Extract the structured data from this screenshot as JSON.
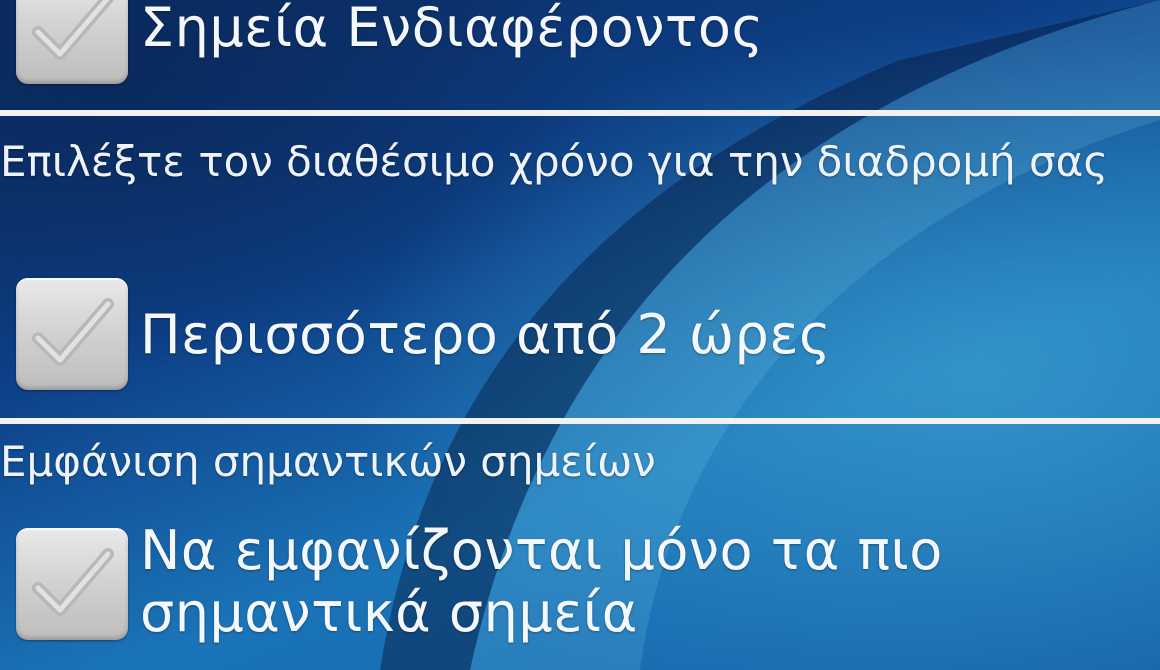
{
  "options": {
    "poi": {
      "label": "Σημεία Ενδιαφέροντος",
      "checked": false
    },
    "time_more_than_2h": {
      "label": "Περισσότερο από 2 ώρες",
      "checked": false
    },
    "important_only": {
      "label": "Να εμφανίζονται μόνο τα πιο σημαντικά σημεία",
      "checked": false
    }
  },
  "sections": {
    "time": {
      "title": "Επιλέξτε τον διαθέσιμο χρόνο για την διαδρομή σας"
    },
    "display": {
      "title": "Εμφάνιση σημαντικών σημείων"
    }
  },
  "colors": {
    "background_dark": "#0b2c62",
    "background_light": "#1b74b8",
    "divider": "#f2f2f2",
    "checkbox": "#d3d3d3"
  }
}
